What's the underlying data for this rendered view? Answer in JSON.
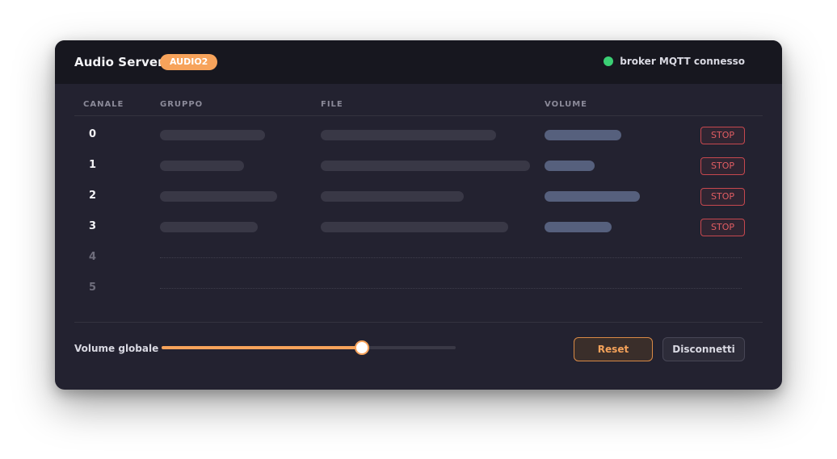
{
  "header": {
    "title": "Audio Server",
    "badge": "AUDIO2",
    "status_text": "broker MQTT connesso",
    "status_color": "#3bcf74"
  },
  "table": {
    "columns": [
      "CANALE",
      "GRUPPO",
      "FILE",
      "VOLUME"
    ],
    "rows": [
      {
        "channel": "0",
        "stop_label": "STOP"
      },
      {
        "channel": "1",
        "stop_label": "STOP"
      },
      {
        "channel": "2",
        "stop_label": "STOP"
      },
      {
        "channel": "3",
        "stop_label": "STOP"
      },
      {
        "channel": "4"
      },
      {
        "channel": "5"
      }
    ]
  },
  "footer": {
    "volume_label": "Volume globale",
    "volume_value": 0.68,
    "reset_label": "Reset",
    "disconnect_label": "Disconnetti"
  },
  "colors": {
    "accent": "#f7a35b",
    "danger": "#e15d63",
    "panel_bg": "#232230",
    "header_bg": "#17171f"
  }
}
